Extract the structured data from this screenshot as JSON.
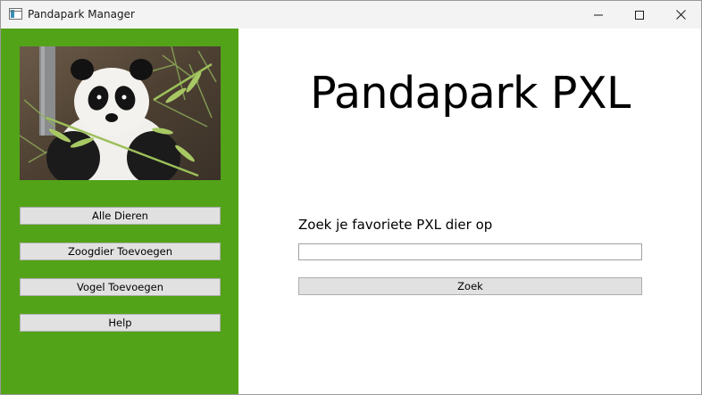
{
  "window": {
    "title": "Pandapark Manager",
    "controls": {
      "minimize": "minimize-icon",
      "maximize": "maximize-icon",
      "close": "close-icon"
    }
  },
  "sidebar": {
    "background_color": "#53a318",
    "image": "panda-photo",
    "buttons": [
      {
        "label": "Alle Dieren"
      },
      {
        "label": "Zoogdier Toevoegen"
      },
      {
        "label": "Vogel Toevoegen"
      },
      {
        "label": "Help"
      }
    ]
  },
  "main": {
    "heading": "Pandapark PXL",
    "search": {
      "label": "Zoek je favoriete PXL dier op",
      "value": "",
      "button_label": "Zoek"
    }
  }
}
